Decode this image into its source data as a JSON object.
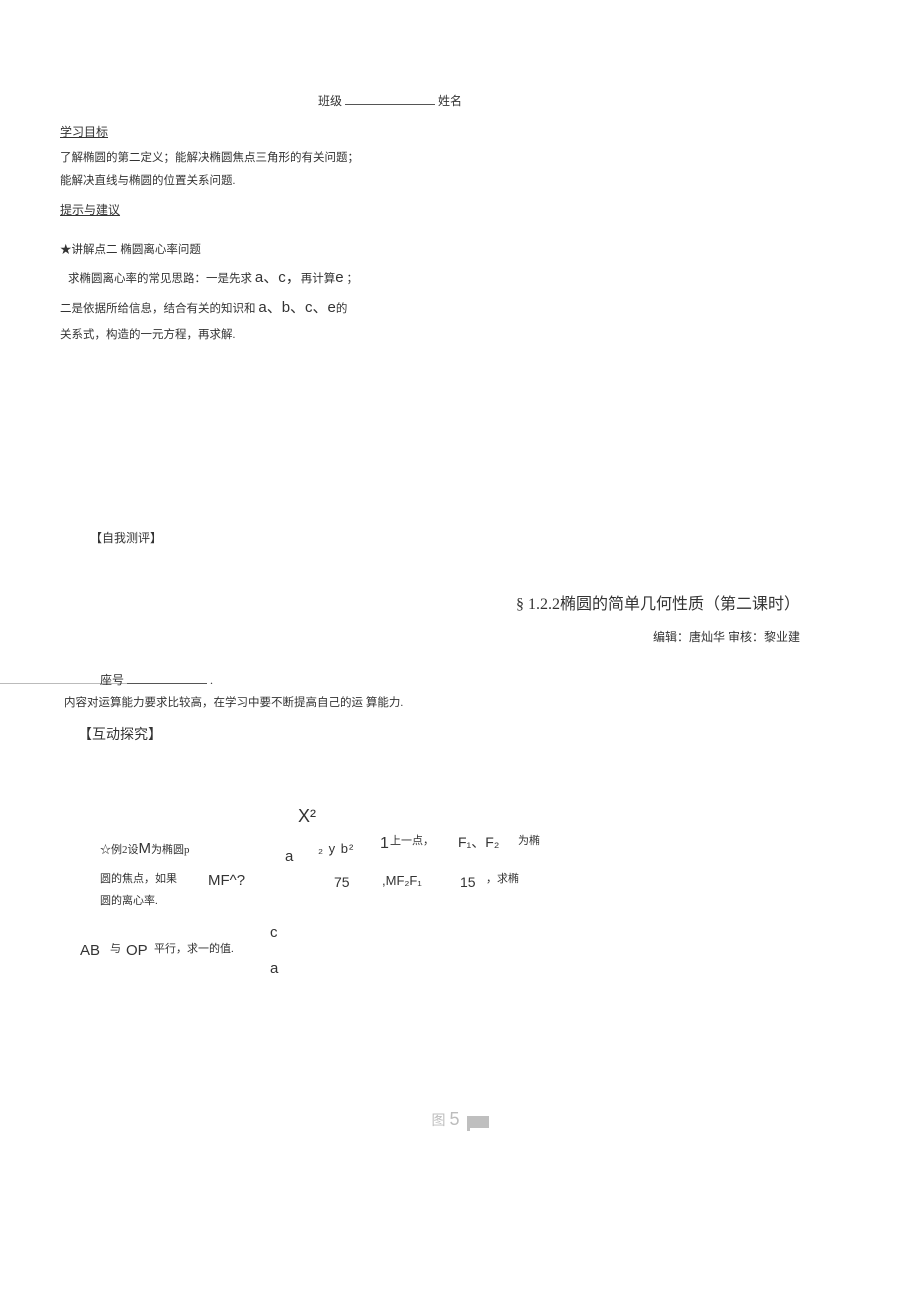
{
  "header": {
    "class_label": "班级",
    "name_label": "姓名"
  },
  "objectives": {
    "heading": "学习目标",
    "line1": "了解椭圆的第二定义；能解决椭圆焦点三角形的有关问题；",
    "line2": "能解决直线与椭圆的位置关系问题."
  },
  "tips": {
    "heading": "提示与建议"
  },
  "point2": {
    "title": "★讲解点二 椭圆离心率问题",
    "line1_a": "求椭圆离心率的常见思路：一是先求 ",
    "line1_vars": "a、c，",
    "line1_b": "再计算",
    "line1_e": "e",
    "line1_c": " ；",
    "line2_a": "二是依据所给信息，结合有关的知识和 ",
    "line2_vars": "a、b、c、e",
    "line2_b": "的",
    "line3": "关系式，构造的一元方程，再求解."
  },
  "self_eval": "【自我测评】",
  "title": {
    "main": "§ 1.2.2椭圆的简单几何性质（第二课时）",
    "sub": "编辑：唐灿华 审核：黎业建"
  },
  "seat": {
    "label": "座号",
    "period": "."
  },
  "content_note": "内容对运算能力要求比较高，在学习中要不断提高自己的运 算能力.",
  "interact": "【互动探究】",
  "example": {
    "prefix": "☆例2设",
    "M": "M",
    "mid1": "为椭圆p",
    "X2": "X²",
    "a": "a",
    "yb": "₂ y b²",
    "one": "1",
    "upper": "上一点，",
    "F": "F₁、F₂",
    "weitu": "为椭",
    "line2a": "圆的焦点，如果 ",
    "MF": "MF^?",
    "v75": "75",
    "comma_MF2": ",MF₂F₁",
    "v15": "15",
    "qiu": " ，求椭",
    "line3": "圆的离心率.",
    "c": "c",
    "AB": "AB",
    "yi": "与",
    "OP": "OP",
    "px": "平行，求一的值.",
    "a2": "a"
  },
  "footer": {
    "tu": "图",
    "num": "5"
  }
}
